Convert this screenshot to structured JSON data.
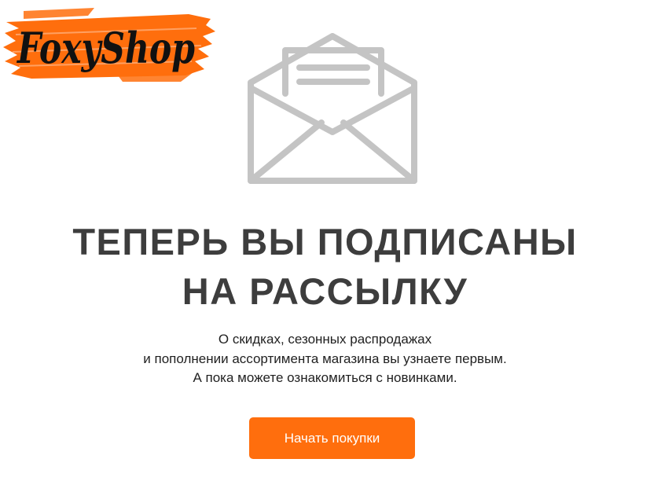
{
  "logo": {
    "text": "FoxyShop",
    "brand_color": "#ff6e0d"
  },
  "envelope": {
    "icon": "open-envelope-icon",
    "color": "#c4c4c4"
  },
  "headline": {
    "line1": "ТЕПЕРЬ ВЫ ПОДПИСАНЫ",
    "line2": "НА РАССЫЛКУ"
  },
  "description": {
    "line1": "О скидках, сезонных распродажах",
    "line2": "и пополнении ассортимента магазина вы узнаете первым.",
    "line3": "А пока можете ознакомиться с новинками."
  },
  "cta": {
    "label": "Начать покупки",
    "color": "#ff6e0d"
  }
}
